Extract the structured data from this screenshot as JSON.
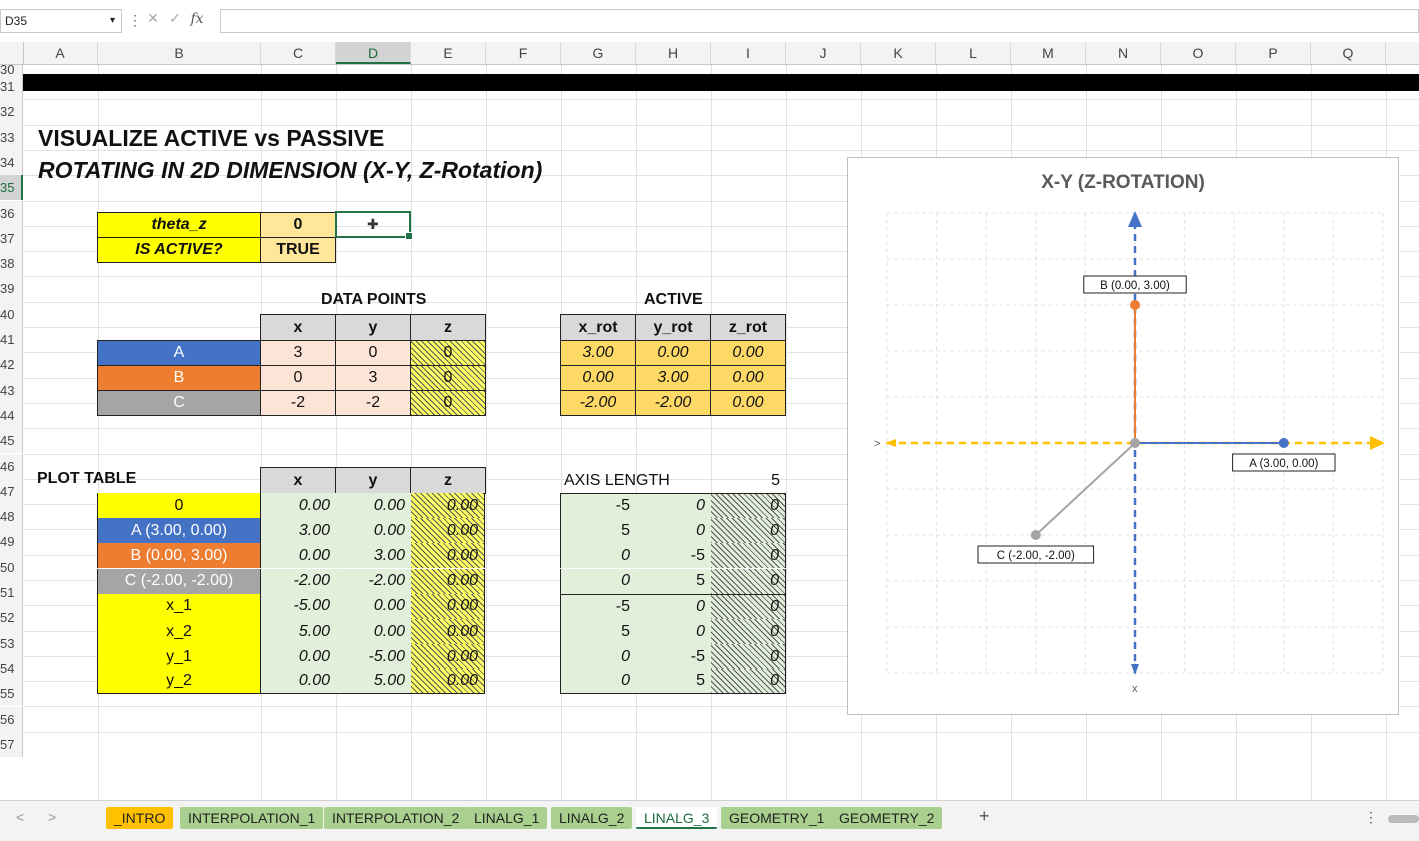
{
  "formula_bar": {
    "name_box": "D35",
    "fx": "fx",
    "cancel": "✕",
    "enter": "✓",
    "formula": ""
  },
  "columns": [
    "A",
    "B",
    "C",
    "D",
    "E",
    "F",
    "G",
    "H",
    "I",
    "J",
    "K",
    "L",
    "M",
    "N",
    "O",
    "P",
    "Q"
  ],
  "selected_column": "D",
  "rows": [
    "30",
    "31",
    "32",
    "33",
    "34",
    "35",
    "36",
    "37",
    "38",
    "39",
    "40",
    "41",
    "42",
    "43",
    "44",
    "45",
    "46",
    "47",
    "48",
    "49",
    "50",
    "51",
    "52",
    "53",
    "54",
    "55",
    "56",
    "57"
  ],
  "selected_row": "35",
  "titles": {
    "line1": "VISUALIZE ACTIVE vs PASSIVE",
    "line2": "ROTATING IN 2D DIMENSION (X-Y, Z-Rotation)"
  },
  "params": {
    "theta_label": "theta_z",
    "theta_value": "0",
    "active_label": "IS ACTIVE?",
    "active_value": "TRUE"
  },
  "data_points": {
    "title": "DATA POINTS",
    "headers": [
      "x",
      "y",
      "z"
    ],
    "rows": [
      {
        "name": "A",
        "x": "3",
        "y": "0",
        "z": "0"
      },
      {
        "name": "B",
        "x": "0",
        "y": "3",
        "z": "0"
      },
      {
        "name": "C",
        "x": "-2",
        "y": "-2",
        "z": "0"
      }
    ]
  },
  "active": {
    "title": "ACTIVE",
    "headers": [
      "x_rot",
      "y_rot",
      "z_rot"
    ],
    "rows": [
      [
        "3.00",
        "0.00",
        "0.00"
      ],
      [
        "0.00",
        "3.00",
        "0.00"
      ],
      [
        "-2.00",
        "-2.00",
        "0.00"
      ]
    ]
  },
  "plot_table": {
    "title": "PLOT TABLE",
    "headers": [
      "x",
      "y",
      "z"
    ],
    "rows": [
      {
        "label": "0",
        "x": "0.00",
        "y": "0.00",
        "z": "0.00"
      },
      {
        "label": "A (3.00, 0.00)",
        "x": "3.00",
        "y": "0.00",
        "z": "0.00"
      },
      {
        "label": "B (0.00, 3.00)",
        "x": "0.00",
        "y": "3.00",
        "z": "0.00"
      },
      {
        "label": "C (-2.00, -2.00)",
        "x": "-2.00",
        "y": "-2.00",
        "z": "0.00"
      },
      {
        "label": "x_1",
        "x": "-5.00",
        "y": "0.00",
        "z": "0.00"
      },
      {
        "label": "x_2",
        "x": "5.00",
        "y": "0.00",
        "z": "0.00"
      },
      {
        "label": "y_1",
        "x": "0.00",
        "y": "-5.00",
        "z": "0.00"
      },
      {
        "label": "y_2",
        "x": "0.00",
        "y": "5.00",
        "z": "0.00"
      }
    ]
  },
  "axis_length": {
    "label": "AXIS LENGTH",
    "value": "5",
    "rows": [
      [
        "-5",
        "0",
        "0"
      ],
      [
        "5",
        "0",
        "0"
      ],
      [
        "0",
        "-5",
        "0"
      ],
      [
        "0",
        "5",
        "0"
      ],
      [
        "-5",
        "0",
        "0"
      ],
      [
        "5",
        "0",
        "0"
      ],
      [
        "0",
        "-5",
        "0"
      ],
      [
        "0",
        "5",
        "0"
      ]
    ]
  },
  "chart_data": {
    "type": "scatter",
    "title": "X-Y (Z-ROTATION)",
    "xlim": [
      -5,
      5
    ],
    "ylim": [
      -5,
      5
    ],
    "grid": true,
    "axis_end_labels": {
      "x_left": ">",
      "y_bottom": "x"
    },
    "series": [
      {
        "points": [
          [
            0,
            0
          ],
          [
            3,
            0
          ]
        ],
        "color": "#4472c4"
      },
      {
        "points": [
          [
            0,
            0
          ],
          [
            0,
            3
          ]
        ],
        "color": "#ed7d31"
      },
      {
        "points": [
          [
            0,
            0
          ],
          [
            -2,
            -2
          ]
        ],
        "color": "#a5a5a5"
      },
      {
        "points": [
          [
            -5,
            0
          ],
          [
            5,
            0
          ]
        ],
        "color": "#ffc000",
        "dashed": true
      },
      {
        "points": [
          [
            0,
            -5
          ],
          [
            0,
            5
          ]
        ],
        "color": "#4472c4",
        "dashed": true
      }
    ],
    "annotations": [
      {
        "text": "A (3.00, 0.00)",
        "x": 3,
        "y": 0
      },
      {
        "text": "B (0.00, 3.00)",
        "x": 0,
        "y": 3
      },
      {
        "text": "C (-2.00, -2.00)",
        "x": -2,
        "y": -2
      }
    ],
    "colors": {
      "a": "#4472c4",
      "b": "#ed7d31",
      "c": "#a5a5a5",
      "x_axis": "#ffc000",
      "y_axis": "#4472c4"
    }
  },
  "sheet_tabs": [
    {
      "label": "_INTRO",
      "color": "#ffc000",
      "active": false
    },
    {
      "label": "INTERPOLATION_1",
      "active": false
    },
    {
      "label": "INTERPOLATION_2",
      "active": false
    },
    {
      "label": "LINALG_1",
      "active": false
    },
    {
      "label": "LINALG_2",
      "active": false
    },
    {
      "label": "LINALG_3",
      "active": true
    },
    {
      "label": "GEOMETRY_1",
      "active": false
    },
    {
      "label": "GEOMETRY_2",
      "active": false
    }
  ],
  "icons": {
    "prev": "chevron-left-icon",
    "next": "chevron-right-icon",
    "add": "plus-icon",
    "more": "more-vertical-icon"
  }
}
